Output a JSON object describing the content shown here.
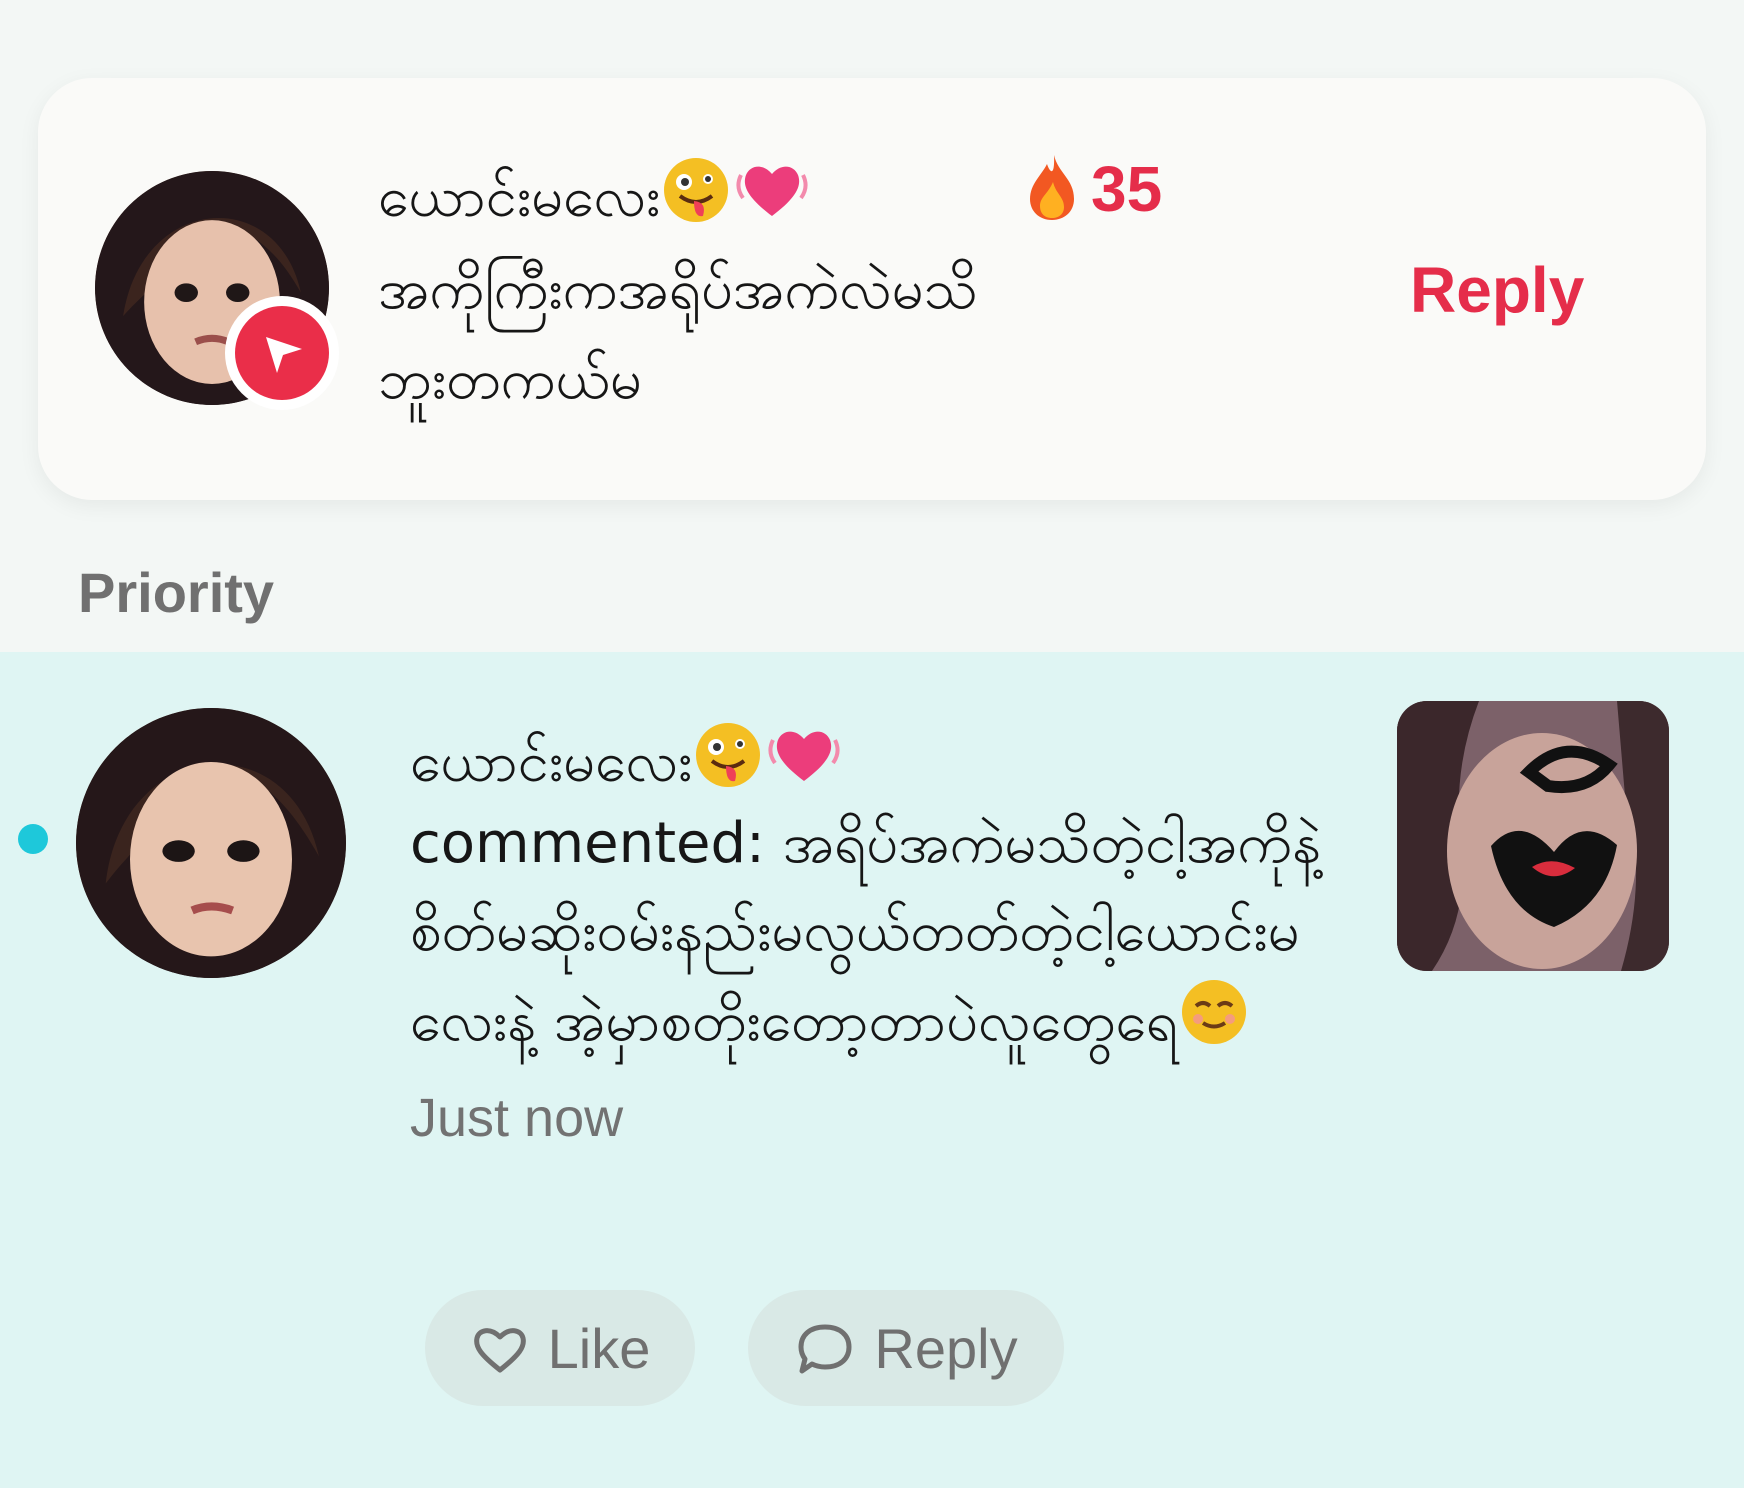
{
  "top_card": {
    "username": "ယောင်းမလေး",
    "streak_count": "35",
    "message": "အကိုကြီးကအရိုပ်အကဲလဲမသိ\nဘူးတကယ်မ",
    "reply_label": "Reply"
  },
  "section": {
    "label": "Priority"
  },
  "notification": {
    "username": "ယောင်းမလေး",
    "comment": "commented: အရိပ်အကဲမသိတဲ့ငါ့အကိုနဲ့ စိတ်မဆိုးဝမ်းနည်းမလွယ်တတ်တဲ့ငါ့ယောင်းမလေးနဲ့ အဲ့မှာစတိုးတော့တာပဲလူတွေရေ",
    "timestamp": "Just now",
    "like_label": "Like",
    "reply_label": "Reply"
  },
  "icons": {
    "avatar": "profile-avatar",
    "send_badge": "send-icon",
    "fire": "fire-icon",
    "silly": "silly-face-icon",
    "heart": "beating-heart-icon",
    "relieved": "relieved-face-icon",
    "like": "heart-outline-icon",
    "reply": "speech-bubble-icon"
  },
  "colors": {
    "accent": "#e52d4a",
    "unread": "#1ec8da",
    "priority_background": "#dff5f3"
  }
}
